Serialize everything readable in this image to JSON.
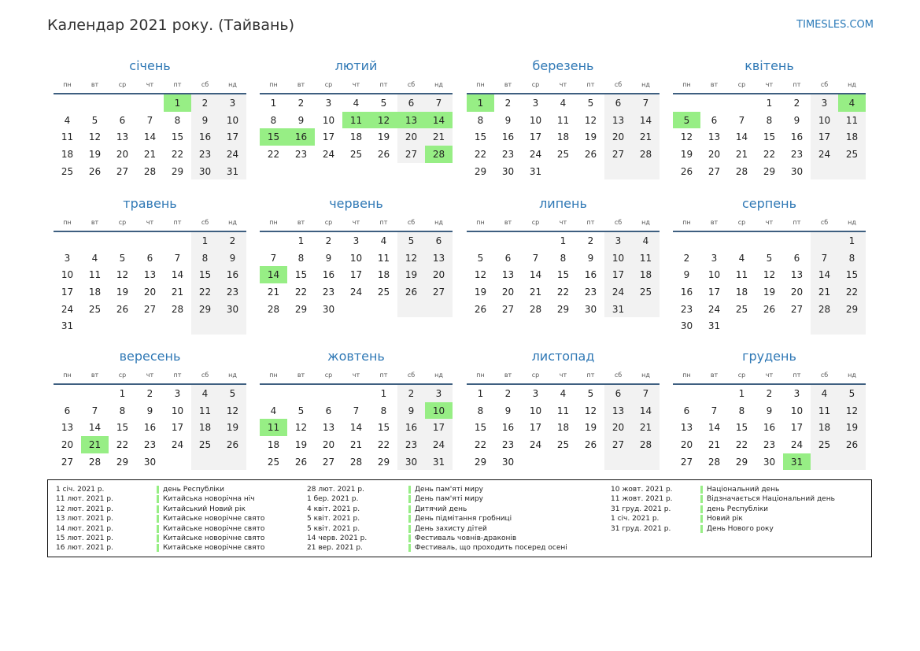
{
  "header": {
    "title": "Календар 2021 року. (Тайвань)",
    "site": "TIMESLES.COM"
  },
  "colors": {
    "accent": "#2f78b5",
    "holiday": "#97ee85",
    "weekend": "#f2f2f2",
    "rule": "#3e5f80"
  },
  "weekdays": [
    "пн",
    "вт",
    "ср",
    "чт",
    "пт",
    "сб",
    "нд"
  ],
  "months": [
    {
      "name": "січень",
      "offset": 4,
      "days": 31,
      "holidays": [
        1
      ]
    },
    {
      "name": "лютий",
      "offset": 0,
      "days": 28,
      "holidays": [
        11,
        12,
        13,
        14,
        15,
        16,
        28
      ]
    },
    {
      "name": "березень",
      "offset": 0,
      "days": 31,
      "holidays": [
        1
      ]
    },
    {
      "name": "квітень",
      "offset": 3,
      "days": 30,
      "holidays": [
        4,
        5
      ]
    },
    {
      "name": "травень",
      "offset": 5,
      "days": 31,
      "holidays": []
    },
    {
      "name": "червень",
      "offset": 1,
      "days": 30,
      "holidays": [
        14
      ]
    },
    {
      "name": "липень",
      "offset": 3,
      "days": 31,
      "holidays": []
    },
    {
      "name": "серпень",
      "offset": 6,
      "days": 31,
      "holidays": []
    },
    {
      "name": "вересень",
      "offset": 2,
      "days": 30,
      "holidays": [
        21
      ]
    },
    {
      "name": "жовтень",
      "offset": 4,
      "days": 31,
      "holidays": [
        10,
        11
      ]
    },
    {
      "name": "листопад",
      "offset": 0,
      "days": 30,
      "holidays": []
    },
    {
      "name": "грудень",
      "offset": 2,
      "days": 31,
      "holidays": [
        31
      ]
    }
  ],
  "legend": [
    [
      {
        "date": "1 січ. 2021 р.",
        "name": "день Республіки"
      },
      {
        "date": "11 лют. 2021 р.",
        "name": "Китайська новорічна ніч"
      },
      {
        "date": "12 лют. 2021 р.",
        "name": "Китайський Новий рік"
      },
      {
        "date": "13 лют. 2021 р.",
        "name": "Китайське новорічне свято"
      },
      {
        "date": "14 лют. 2021 р.",
        "name": "Китайське новорічне свято"
      },
      {
        "date": "15 лют. 2021 р.",
        "name": "Китайське новорічне свято"
      },
      {
        "date": "16 лют. 2021 р.",
        "name": "Китайське новорічне свято"
      }
    ],
    [
      {
        "date": "28 лют. 2021 р.",
        "name": "День пам'яті миру"
      },
      {
        "date": "1 бер. 2021 р.",
        "name": "День пам'яті миру"
      },
      {
        "date": "4 квіт. 2021 р.",
        "name": "Дитячий день"
      },
      {
        "date": "5 квіт. 2021 р.",
        "name": "День підмітання гробниці"
      },
      {
        "date": "5 квіт. 2021 р.",
        "name": "День захисту дітей"
      },
      {
        "date": "14 черв. 2021 р.",
        "name": "Фестиваль човнів-драконів"
      },
      {
        "date": "21 вер. 2021 р.",
        "name": "Фестиваль, що проходить посеред осені"
      }
    ],
    [
      {
        "date": "10 жовт. 2021 р.",
        "name": "Національний день"
      },
      {
        "date": "11 жовт. 2021 р.",
        "name": "Відзначається Національний день"
      },
      {
        "date": "31 груд. 2021 р.",
        "name": "день Республіки"
      },
      {
        "date": "1 січ. 2021 р.",
        "name": "Новий рік"
      },
      {
        "date": "31 груд. 2021 р.",
        "name": "День Нового року"
      }
    ]
  ]
}
